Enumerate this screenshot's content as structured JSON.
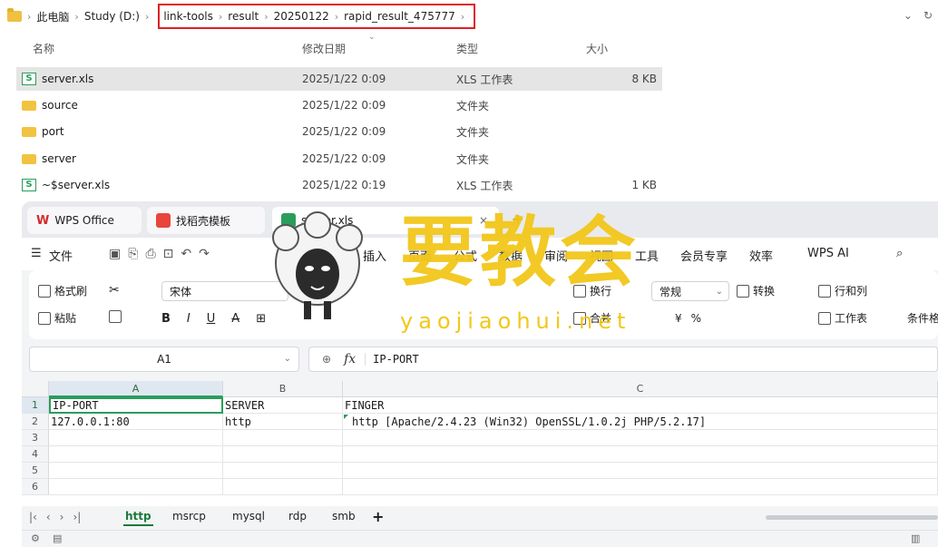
{
  "explorer": {
    "breadcrumb_plain": [
      "此电脑",
      "Study (D:)"
    ],
    "breadcrumb_boxed": [
      "link-tools",
      "result",
      "20250122",
      "rapid_result_475777"
    ],
    "columns": {
      "name": "名称",
      "date": "修改日期",
      "type": "类型",
      "size": "大小"
    },
    "files": [
      {
        "name": "server.xls",
        "date": "2025/1/22 0:09",
        "type": "XLS 工作表",
        "size": "8 KB",
        "icon": "xls-icon"
      },
      {
        "name": "source",
        "date": "2025/1/22 0:09",
        "type": "文件夹",
        "size": "",
        "icon": "folder-icon"
      },
      {
        "name": "port",
        "date": "2025/1/22 0:09",
        "type": "文件夹",
        "size": "",
        "icon": "folder-icon"
      },
      {
        "name": "server",
        "date": "2025/1/22 0:09",
        "type": "文件夹",
        "size": "",
        "icon": "folder-icon"
      },
      {
        "name": "~$server.xls",
        "date": "2025/1/22 0:19",
        "type": "XLS 工作表",
        "size": "1 KB",
        "icon": "xls-icon"
      }
    ]
  },
  "wps": {
    "tabs": [
      "WPS Office",
      "找稻壳模板",
      "server.xls"
    ],
    "menu": [
      "文件",
      "开始",
      "插入",
      "页面",
      "公式",
      "数据",
      "审阅",
      "视图",
      "工具",
      "会员专享",
      "效率",
      "WPS AI"
    ],
    "ribbon": {
      "format_painter": "格式刷",
      "paste": "粘贴",
      "font": "宋体",
      "wrap": "换行",
      "number_format": "常规",
      "convert": "转换",
      "row_col": "行和列",
      "merge": "合并",
      "worksheet": "工作表",
      "conditional": "条件格",
      "percent": "%"
    },
    "name_box": "A1",
    "formula": "IP-PORT",
    "col_headers": [
      "A",
      "B",
      "C"
    ],
    "row_headers": [
      "1",
      "2",
      "3",
      "4",
      "5",
      "6"
    ],
    "cells": {
      "a1": "IP-PORT",
      "b1": "SERVER",
      "c1": "FINGER",
      "a2": "127.0.0.1:80",
      "b2": "http",
      "c2": "http [Apache/2.4.23 (Win32) OpenSSL/1.0.2j PHP/5.2.17]"
    },
    "sheets": [
      "http",
      "msrcp",
      "mysql",
      "rdp",
      "smb"
    ],
    "add_sheet": "+"
  },
  "watermark": {
    "text": "要教会",
    "url": "yaojiaohui.net"
  },
  "colors": {
    "accent_green": "#2a9d5c",
    "highlight_red": "#e02020",
    "watermark_yellow": "#f2c71a"
  }
}
